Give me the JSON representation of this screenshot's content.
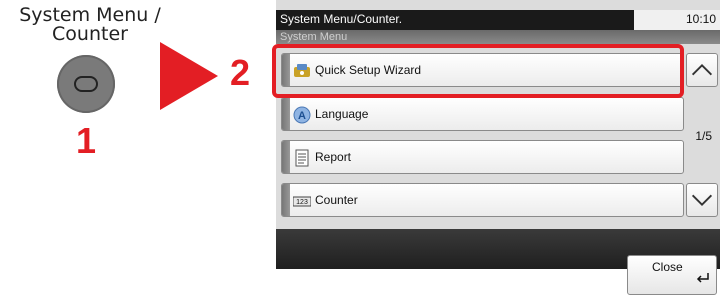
{
  "instruction": {
    "key_label_line1": "System Menu /",
    "key_label_line2": "Counter",
    "step1": "1",
    "step2": "2"
  },
  "panel": {
    "title": "System Menu/Counter.",
    "time": "10:10",
    "subtitle": "System Menu",
    "page_indicator": "1/5",
    "menu_items": [
      {
        "label": "Quick Setup Wizard",
        "icon": "wizard-icon"
      },
      {
        "label": "Language",
        "icon": "language-icon"
      },
      {
        "label": "Report",
        "icon": "report-icon"
      },
      {
        "label": "Counter",
        "icon": "counter-icon"
      }
    ],
    "close_label": "Close"
  },
  "colors": {
    "accent": "#e31e24",
    "status_bar": "#1a1a1a",
    "panel_bg": "#dcdcdc"
  }
}
